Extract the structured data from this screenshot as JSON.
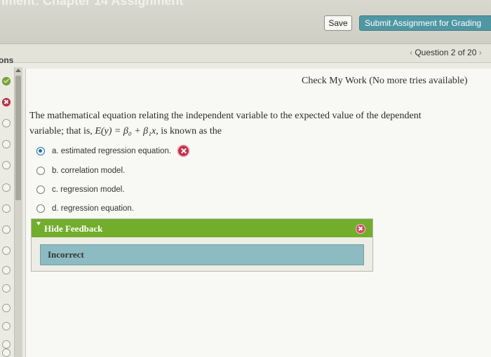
{
  "page_title": "nment: Chapter 14 Assignment",
  "toolbar": {
    "save_label": "Save",
    "submit_label": "Submit Assignment for Grading"
  },
  "sidebar": {
    "title": "ons",
    "statuses": [
      "correct",
      "wrong",
      "unanswered",
      "unanswered",
      "unanswered",
      "unanswered",
      "unanswered",
      "unanswered",
      "unanswered",
      "unanswered",
      "unanswered",
      "unanswered",
      "unanswered",
      "unanswered",
      "unanswered"
    ]
  },
  "nav": {
    "prev_arrow": "‹",
    "question_label": "Question 2 of 20",
    "next_arrow": "›"
  },
  "check_work": "Check My Work (No more tries available)",
  "question": {
    "line1": "The mathematical equation relating the independent variable to the expected value of the dependent",
    "line2_prefix": "variable; that is, ",
    "equation": "E(y) = β₀ + β₁x",
    "line2_suffix": ", is known as the"
  },
  "options": [
    {
      "label": "a. estimated regression equation.",
      "selected": true,
      "marked_wrong": true
    },
    {
      "label": "b. correlation model.",
      "selected": false,
      "marked_wrong": false
    },
    {
      "label": "c. regression model.",
      "selected": false,
      "marked_wrong": false
    },
    {
      "label": "d. regression equation.",
      "selected": false,
      "marked_wrong": false
    }
  ],
  "feedback": {
    "toggle_label": "Hide Feedback",
    "result": "Incorrect"
  },
  "colors": {
    "submit": "#4f97a3",
    "feedback_header": "#72ad2c",
    "feedback_result": "#8cbcc2",
    "wrong": "#c5334d",
    "correct": "#7aa637",
    "radio_selected": "#1f6fb0"
  }
}
